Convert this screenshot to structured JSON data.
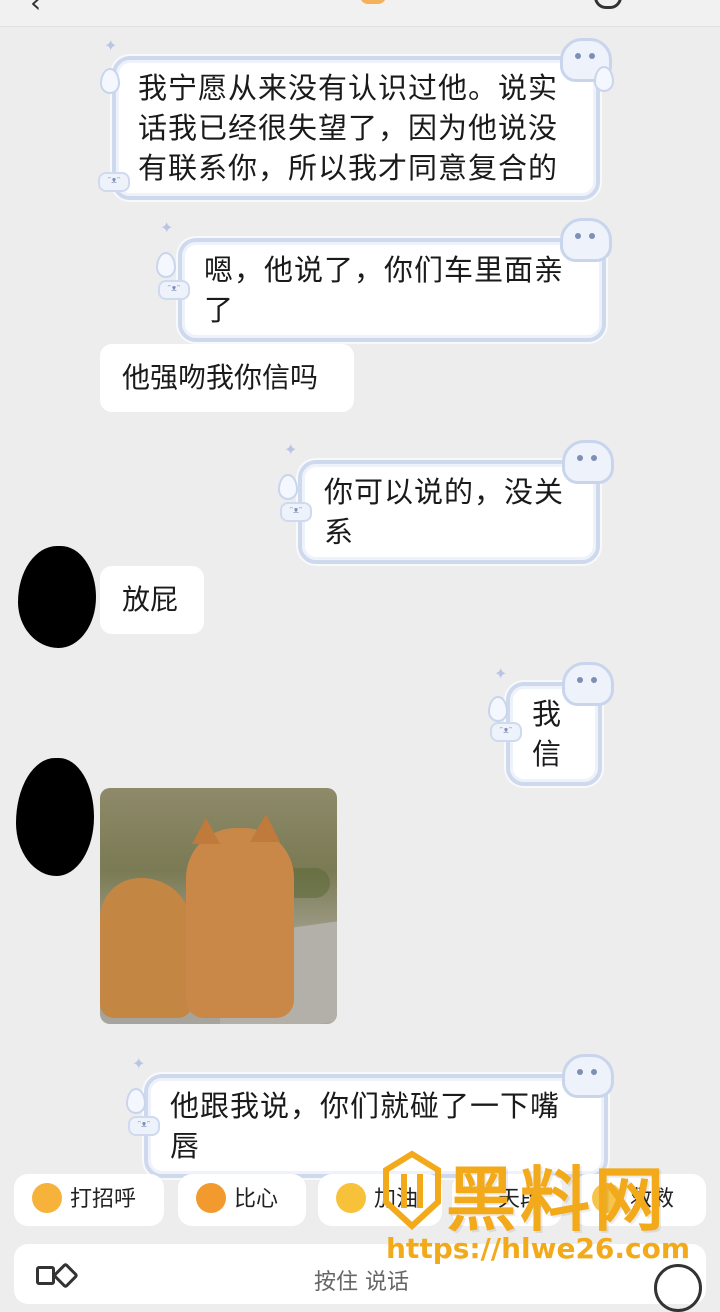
{
  "messages": [
    {
      "text": "我宁愿从来没有认识过他。说实话我已经很失望了，因为他说没有联系你，所以我才同意复合的"
    },
    {
      "text": "嗯，他说了，你们车里面亲了"
    },
    {
      "text": "他强吻我你信吗"
    },
    {
      "text": "你可以说的，没关系"
    },
    {
      "text": "放屁"
    },
    {
      "text": "我信"
    },
    {
      "text": "他跟我说，你们就碰了一下嘴唇"
    }
  ],
  "quick_replies": [
    "打招呼",
    "比心",
    "加油",
    "天段",
    "救救"
  ],
  "input": {
    "placeholder": "按住 说话"
  },
  "watermark": {
    "brand": "黑料网",
    "url": "https://hlwe26.com"
  }
}
